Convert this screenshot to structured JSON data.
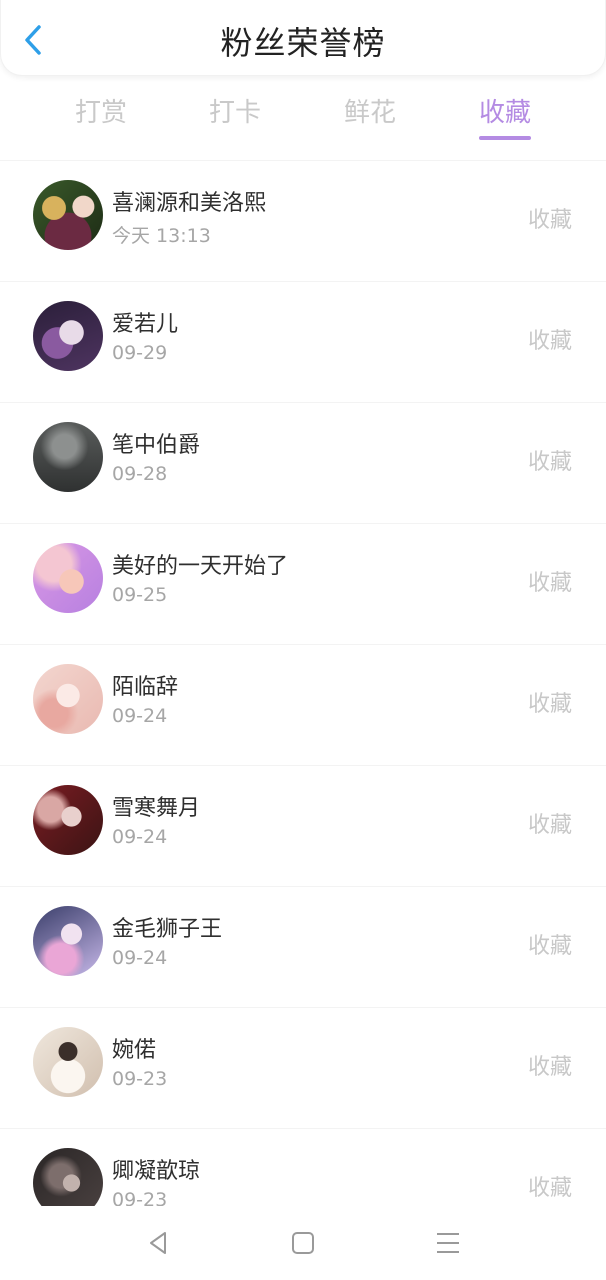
{
  "header": {
    "title": "粉丝荣誉榜"
  },
  "tabs": [
    {
      "label": "打赏",
      "active": false
    },
    {
      "label": "打卡",
      "active": false
    },
    {
      "label": "鲜花",
      "active": false
    },
    {
      "label": "收藏",
      "active": true
    }
  ],
  "colors": {
    "accent": "#b48be3",
    "back_icon": "#2e9fe8"
  },
  "list": [
    {
      "name": "喜澜源和美洛熙",
      "time": "今天 13:13",
      "action": "收藏",
      "avatar_colors": [
        "#3a5a2a",
        "#d8b25d",
        "#6b2a42"
      ]
    },
    {
      "name": "爱若儿",
      "time": "09-29",
      "action": "收藏",
      "avatar_colors": [
        "#2b1f3a",
        "#c9b8d6",
        "#8a5aa0"
      ]
    },
    {
      "name": "笔中伯爵",
      "time": "09-28",
      "action": "收藏",
      "avatar_colors": [
        "#3b3d3d",
        "#6a6d6c",
        "#8d908f"
      ]
    },
    {
      "name": "美好的一天开始了",
      "time": "09-25",
      "action": "收藏",
      "avatar_colors": [
        "#d998e5",
        "#f4c6d2",
        "#b780e0"
      ]
    },
    {
      "name": "陌临辞",
      "time": "09-24",
      "action": "收藏",
      "avatar_colors": [
        "#f3d6cf",
        "#e8a8a0",
        "#fbeae6"
      ]
    },
    {
      "name": "雪寒舞月",
      "time": "09-24",
      "action": "收藏",
      "avatar_colors": [
        "#7a1c22",
        "#d9a7a4",
        "#3b1414"
      ]
    },
    {
      "name": "金毛狮子王",
      "time": "09-24",
      "action": "收藏",
      "avatar_colors": [
        "#3a3e6a",
        "#c6b7e8",
        "#eaa6d6"
      ]
    },
    {
      "name": "婉偌",
      "time": "09-23",
      "action": "收藏",
      "avatar_colors": [
        "#efe7dd",
        "#d1bfae",
        "#9a8573"
      ]
    },
    {
      "name": "卿凝歆琼",
      "time": "09-23",
      "action": "收藏",
      "avatar_colors": [
        "#2a2626",
        "#7d6e6c",
        "#c2b2ad"
      ]
    }
  ],
  "bottom_nav": {
    "icons": [
      "back-triangle-icon",
      "home-square-icon",
      "menu-lines-icon"
    ]
  }
}
